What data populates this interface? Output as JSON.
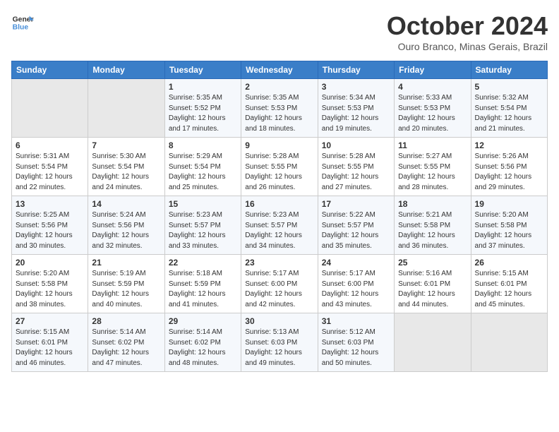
{
  "logo": {
    "line1": "General",
    "line2": "Blue"
  },
  "title": "October 2024",
  "subtitle": "Ouro Branco, Minas Gerais, Brazil",
  "days_of_week": [
    "Sunday",
    "Monday",
    "Tuesday",
    "Wednesday",
    "Thursday",
    "Friday",
    "Saturday"
  ],
  "weeks": [
    [
      {
        "day": "",
        "info": ""
      },
      {
        "day": "",
        "info": ""
      },
      {
        "day": "1",
        "info": "Sunrise: 5:35 AM\nSunset: 5:52 PM\nDaylight: 12 hours\nand 17 minutes."
      },
      {
        "day": "2",
        "info": "Sunrise: 5:35 AM\nSunset: 5:53 PM\nDaylight: 12 hours\nand 18 minutes."
      },
      {
        "day": "3",
        "info": "Sunrise: 5:34 AM\nSunset: 5:53 PM\nDaylight: 12 hours\nand 19 minutes."
      },
      {
        "day": "4",
        "info": "Sunrise: 5:33 AM\nSunset: 5:53 PM\nDaylight: 12 hours\nand 20 minutes."
      },
      {
        "day": "5",
        "info": "Sunrise: 5:32 AM\nSunset: 5:54 PM\nDaylight: 12 hours\nand 21 minutes."
      }
    ],
    [
      {
        "day": "6",
        "info": "Sunrise: 5:31 AM\nSunset: 5:54 PM\nDaylight: 12 hours\nand 22 minutes."
      },
      {
        "day": "7",
        "info": "Sunrise: 5:30 AM\nSunset: 5:54 PM\nDaylight: 12 hours\nand 24 minutes."
      },
      {
        "day": "8",
        "info": "Sunrise: 5:29 AM\nSunset: 5:54 PM\nDaylight: 12 hours\nand 25 minutes."
      },
      {
        "day": "9",
        "info": "Sunrise: 5:28 AM\nSunset: 5:55 PM\nDaylight: 12 hours\nand 26 minutes."
      },
      {
        "day": "10",
        "info": "Sunrise: 5:28 AM\nSunset: 5:55 PM\nDaylight: 12 hours\nand 27 minutes."
      },
      {
        "day": "11",
        "info": "Sunrise: 5:27 AM\nSunset: 5:55 PM\nDaylight: 12 hours\nand 28 minutes."
      },
      {
        "day": "12",
        "info": "Sunrise: 5:26 AM\nSunset: 5:56 PM\nDaylight: 12 hours\nand 29 minutes."
      }
    ],
    [
      {
        "day": "13",
        "info": "Sunrise: 5:25 AM\nSunset: 5:56 PM\nDaylight: 12 hours\nand 30 minutes."
      },
      {
        "day": "14",
        "info": "Sunrise: 5:24 AM\nSunset: 5:56 PM\nDaylight: 12 hours\nand 32 minutes."
      },
      {
        "day": "15",
        "info": "Sunrise: 5:23 AM\nSunset: 5:57 PM\nDaylight: 12 hours\nand 33 minutes."
      },
      {
        "day": "16",
        "info": "Sunrise: 5:23 AM\nSunset: 5:57 PM\nDaylight: 12 hours\nand 34 minutes."
      },
      {
        "day": "17",
        "info": "Sunrise: 5:22 AM\nSunset: 5:57 PM\nDaylight: 12 hours\nand 35 minutes."
      },
      {
        "day": "18",
        "info": "Sunrise: 5:21 AM\nSunset: 5:58 PM\nDaylight: 12 hours\nand 36 minutes."
      },
      {
        "day": "19",
        "info": "Sunrise: 5:20 AM\nSunset: 5:58 PM\nDaylight: 12 hours\nand 37 minutes."
      }
    ],
    [
      {
        "day": "20",
        "info": "Sunrise: 5:20 AM\nSunset: 5:58 PM\nDaylight: 12 hours\nand 38 minutes."
      },
      {
        "day": "21",
        "info": "Sunrise: 5:19 AM\nSunset: 5:59 PM\nDaylight: 12 hours\nand 40 minutes."
      },
      {
        "day": "22",
        "info": "Sunrise: 5:18 AM\nSunset: 5:59 PM\nDaylight: 12 hours\nand 41 minutes."
      },
      {
        "day": "23",
        "info": "Sunrise: 5:17 AM\nSunset: 6:00 PM\nDaylight: 12 hours\nand 42 minutes."
      },
      {
        "day": "24",
        "info": "Sunrise: 5:17 AM\nSunset: 6:00 PM\nDaylight: 12 hours\nand 43 minutes."
      },
      {
        "day": "25",
        "info": "Sunrise: 5:16 AM\nSunset: 6:01 PM\nDaylight: 12 hours\nand 44 minutes."
      },
      {
        "day": "26",
        "info": "Sunrise: 5:15 AM\nSunset: 6:01 PM\nDaylight: 12 hours\nand 45 minutes."
      }
    ],
    [
      {
        "day": "27",
        "info": "Sunrise: 5:15 AM\nSunset: 6:01 PM\nDaylight: 12 hours\nand 46 minutes."
      },
      {
        "day": "28",
        "info": "Sunrise: 5:14 AM\nSunset: 6:02 PM\nDaylight: 12 hours\nand 47 minutes."
      },
      {
        "day": "29",
        "info": "Sunrise: 5:14 AM\nSunset: 6:02 PM\nDaylight: 12 hours\nand 48 minutes."
      },
      {
        "day": "30",
        "info": "Sunrise: 5:13 AM\nSunset: 6:03 PM\nDaylight: 12 hours\nand 49 minutes."
      },
      {
        "day": "31",
        "info": "Sunrise: 5:12 AM\nSunset: 6:03 PM\nDaylight: 12 hours\nand 50 minutes."
      },
      {
        "day": "",
        "info": ""
      },
      {
        "day": "",
        "info": ""
      }
    ]
  ]
}
